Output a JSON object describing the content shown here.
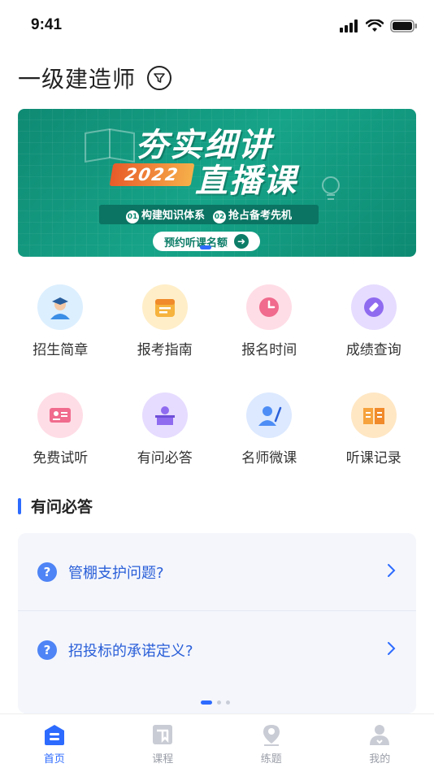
{
  "status_bar": {
    "time": "9:41"
  },
  "header": {
    "title": "一级建造师"
  },
  "banner": {
    "title": "夯实细讲",
    "year": "2022",
    "subtitle": "直播课",
    "points": [
      {
        "num": "01",
        "text": "构建知识体系"
      },
      {
        "num": "02",
        "text": "抢占备考先机"
      }
    ],
    "cta": "预约听课名额"
  },
  "grid": {
    "rows": [
      [
        {
          "label": "招生简章",
          "icon": "student-icon",
          "color": "#5fb6f0"
        },
        {
          "label": "报考指南",
          "icon": "calendar-icon",
          "color": "#f6b33d"
        },
        {
          "label": "报名时间",
          "icon": "clock-icon",
          "color": "#f06b8d"
        },
        {
          "label": "成绩查询",
          "icon": "satellite-icon",
          "color": "#8f6bf0"
        }
      ],
      [
        {
          "label": "免费试听",
          "icon": "id-card-icon",
          "color": "#f06b8d"
        },
        {
          "label": "有问必答",
          "icon": "teacher-desk-icon",
          "color": "#8f6bf0"
        },
        {
          "label": "名师微课",
          "icon": "lecturer-icon",
          "color": "#4d8df5"
        },
        {
          "label": "听课记录",
          "icon": "book-icon",
          "color": "#f6a23d"
        }
      ]
    ]
  },
  "qa_section": {
    "title": "有问必答",
    "items": [
      {
        "question": "管棚支护问题?"
      },
      {
        "question": "招投标的承诺定义?"
      }
    ]
  },
  "tabbar": {
    "tabs": [
      {
        "label": "首页",
        "icon": "home-icon",
        "active": true
      },
      {
        "label": "课程",
        "icon": "course-icon",
        "active": false
      },
      {
        "label": "练题",
        "icon": "practice-icon",
        "active": false
      },
      {
        "label": "我的",
        "icon": "profile-icon",
        "active": false
      }
    ]
  },
  "colors": {
    "accent": "#2d6bff",
    "banner": "#0f8a73"
  }
}
